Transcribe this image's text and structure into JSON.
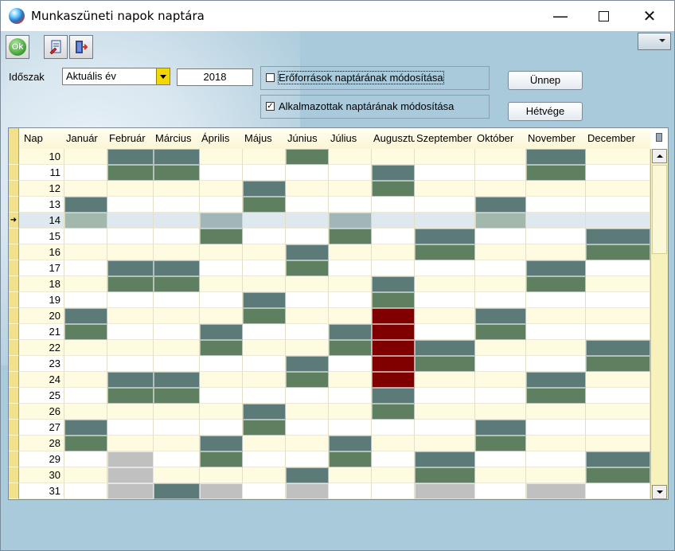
{
  "window": {
    "title": "Munkaszüneti napok naptára"
  },
  "toolbar": {
    "ok_label": "Ok",
    "exit_icon": "exit-door-icon",
    "edit_icon": "edit-document-icon"
  },
  "filters": {
    "period_label": "Időszak",
    "period_value": "Aktuális év",
    "year_value": "2018",
    "checkbox_resources": {
      "label": "Erőforrások naptárának módosítása",
      "checked": false
    },
    "checkbox_employees": {
      "label": "Alkalmazottak naptárának módosítása",
      "checked": true
    }
  },
  "buttons": {
    "holiday": "Ünnep",
    "weekend": "Hétvége"
  },
  "colors": {
    "weekend_saturday": "#5c7a78",
    "weekend_sunday": "#5e7f60",
    "holiday": "#800000",
    "invalid_day": "#c0c0c0",
    "row_alt": "#fffbe0",
    "selected_row": "#dde9ee"
  },
  "grid": {
    "columns": [
      "Nap",
      "Január",
      "Február",
      "Március",
      "Április",
      "Május",
      "Június",
      "Július",
      "Augusztus",
      "Szeptember",
      "Október",
      "November",
      "December"
    ],
    "selected_day": 14,
    "rows": [
      {
        "day": 10,
        "cells": [
          ".",
          "s",
          "s",
          ".",
          ".",
          "g",
          ".",
          ".",
          ".",
          ".",
          "s",
          "."
        ]
      },
      {
        "day": 11,
        "cells": [
          ".",
          "g",
          "g",
          ".",
          ".",
          ".",
          ".",
          "s",
          ".",
          ".",
          "g",
          "."
        ]
      },
      {
        "day": 12,
        "cells": [
          ".",
          ".",
          ".",
          ".",
          "s",
          ".",
          ".",
          "g",
          ".",
          ".",
          ".",
          "."
        ]
      },
      {
        "day": 13,
        "cells": [
          "s",
          ".",
          ".",
          ".",
          "g",
          ".",
          ".",
          ".",
          ".",
          "s",
          ".",
          "."
        ]
      },
      {
        "day": 14,
        "cells": [
          "g",
          ".",
          ".",
          "s",
          ".",
          ".",
          "s",
          ".",
          ".",
          "g",
          ".",
          "."
        ]
      },
      {
        "day": 15,
        "cells": [
          ".",
          ".",
          ".",
          "g",
          ".",
          ".",
          "g",
          ".",
          "s",
          ".",
          ".",
          "s"
        ]
      },
      {
        "day": 16,
        "cells": [
          ".",
          ".",
          ".",
          ".",
          ".",
          "s",
          ".",
          ".",
          "g",
          ".",
          ".",
          "g"
        ]
      },
      {
        "day": 17,
        "cells": [
          ".",
          "s",
          "s",
          ".",
          ".",
          "g",
          ".",
          ".",
          ".",
          ".",
          "s",
          "."
        ]
      },
      {
        "day": 18,
        "cells": [
          ".",
          "g",
          "g",
          ".",
          ".",
          ".",
          ".",
          "s",
          ".",
          ".",
          "g",
          "."
        ]
      },
      {
        "day": 19,
        "cells": [
          ".",
          ".",
          ".",
          ".",
          "s",
          ".",
          ".",
          "g",
          ".",
          ".",
          ".",
          "."
        ]
      },
      {
        "day": 20,
        "cells": [
          "s",
          ".",
          ".",
          ".",
          "g",
          ".",
          ".",
          "r",
          ".",
          "s",
          ".",
          "."
        ]
      },
      {
        "day": 21,
        "cells": [
          "g",
          ".",
          ".",
          "s",
          ".",
          ".",
          "s",
          "r",
          ".",
          "g",
          ".",
          "."
        ]
      },
      {
        "day": 22,
        "cells": [
          ".",
          ".",
          ".",
          "g",
          ".",
          ".",
          "g",
          "r",
          "s",
          ".",
          ".",
          "s"
        ]
      },
      {
        "day": 23,
        "cells": [
          ".",
          ".",
          ".",
          ".",
          ".",
          "s",
          ".",
          "r",
          "g",
          ".",
          ".",
          "g"
        ]
      },
      {
        "day": 24,
        "cells": [
          ".",
          "s",
          "s",
          ".",
          ".",
          "g",
          ".",
          "r",
          ".",
          ".",
          "s",
          "."
        ]
      },
      {
        "day": 25,
        "cells": [
          ".",
          "g",
          "g",
          ".",
          ".",
          ".",
          ".",
          "s",
          ".",
          ".",
          "g",
          "."
        ]
      },
      {
        "day": 26,
        "cells": [
          ".",
          ".",
          ".",
          ".",
          "s",
          ".",
          ".",
          "g",
          ".",
          ".",
          ".",
          "."
        ]
      },
      {
        "day": 27,
        "cells": [
          "s",
          ".",
          ".",
          ".",
          "g",
          ".",
          ".",
          ".",
          ".",
          "s",
          ".",
          "."
        ]
      },
      {
        "day": 28,
        "cells": [
          "g",
          ".",
          ".",
          "s",
          ".",
          ".",
          "s",
          ".",
          ".",
          "g",
          ".",
          "."
        ]
      },
      {
        "day": 29,
        "cells": [
          ".",
          "l",
          ".",
          "g",
          ".",
          ".",
          "g",
          ".",
          "s",
          ".",
          ".",
          "s"
        ]
      },
      {
        "day": 30,
        "cells": [
          ".",
          "l",
          ".",
          ".",
          ".",
          "s",
          ".",
          ".",
          "g",
          ".",
          ".",
          "g"
        ]
      },
      {
        "day": 31,
        "cells": [
          ".",
          "l",
          "s",
          "l",
          ".",
          "l",
          ".",
          ".",
          "l",
          ".",
          "l",
          "."
        ]
      }
    ]
  }
}
